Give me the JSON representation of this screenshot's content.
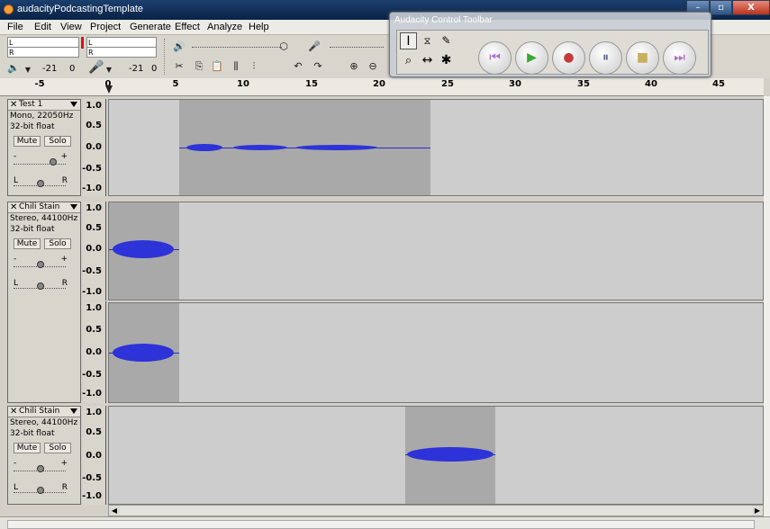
{
  "window": {
    "title": "audacityPodcastingTemplate",
    "min_label": "–",
    "max_label": "▫",
    "close_label": "X"
  },
  "menu": [
    "File",
    "Edit",
    "View",
    "Project",
    "Generate",
    "Effect",
    "Analyze",
    "Help"
  ],
  "meters": {
    "play_db": "-21",
    "play_db2": "0",
    "rec_db": "-21",
    "rec_db2": "0",
    "left": "L",
    "right": "R"
  },
  "ruler": {
    "ticks": [
      "-5",
      "0",
      "5",
      "10",
      "15",
      "20",
      "25",
      "30",
      "35",
      "40",
      "45"
    ]
  },
  "control_toolbar": {
    "title": "Audacity Control Toolbar"
  },
  "tracks": [
    {
      "name": "Test 1",
      "format": "Mono, 22050Hz",
      "bits": "32-bit float",
      "mute": "Mute",
      "solo": "Solo",
      "scale": [
        "1.0",
        "0.5",
        "0.0",
        "-0.5",
        "-1.0"
      ]
    },
    {
      "name": "Chili Stain",
      "format": "Stereo, 44100Hz",
      "bits": "32-bit float",
      "mute": "Mute",
      "solo": "Solo",
      "scale": [
        "1.0",
        "0.5",
        "0.0",
        "-0.5",
        "-1.0"
      ],
      "scale2": [
        "1.0",
        "0.5",
        "0.0",
        "-0.5",
        "-1.0"
      ]
    },
    {
      "name": "Chili Stain",
      "format": "Stereo, 44100Hz",
      "bits": "32-bit float",
      "mute": "Mute",
      "solo": "Solo",
      "scale": [
        "1.0",
        "0.5",
        "0.0",
        "-0.5",
        "-1.0"
      ]
    }
  ],
  "slider": {
    "gain_minus": "-",
    "gain_plus": "+",
    "pan_left": "L",
    "pan_right": "R"
  }
}
